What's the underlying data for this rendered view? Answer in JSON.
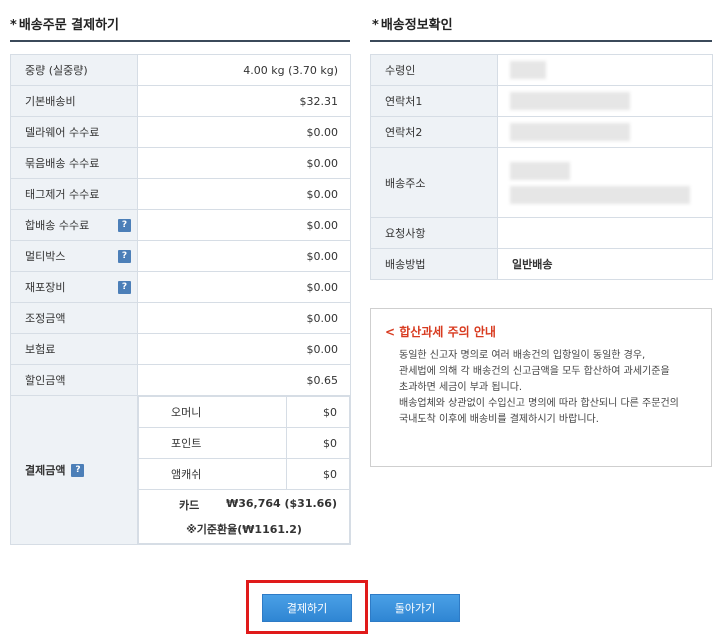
{
  "order_section": {
    "star": "*",
    "title": "배송주문 결제하기",
    "rows": [
      {
        "label": "중량 (실중량)",
        "value": "4.00 kg (3.70 kg)",
        "help": false
      },
      {
        "label": "기본배송비",
        "value": "$32.31",
        "help": false
      },
      {
        "label": "델라웨어 수수료",
        "value": "$0.00",
        "help": false
      },
      {
        "label": "묶음배송 수수료",
        "value": "$0.00",
        "help": false
      },
      {
        "label": "태그제거 수수료",
        "value": "$0.00",
        "help": false
      },
      {
        "label": "합배송 수수료",
        "value": "$0.00",
        "help": true
      },
      {
        "label": "멀티박스",
        "value": "$0.00",
        "help": true
      },
      {
        "label": "재포장비",
        "value": "$0.00",
        "help": true
      },
      {
        "label": "조정금액",
        "value": "$0.00",
        "help": false
      },
      {
        "label": "보험료",
        "value": "$0.00",
        "help": false
      },
      {
        "label": "할인금액",
        "value": "$0.65",
        "help": false
      }
    ],
    "payment": {
      "label": "결제금액",
      "help_glyph": "?",
      "items": [
        {
          "label": "오머니",
          "value": "$0"
        },
        {
          "label": "포인트",
          "value": "$0"
        },
        {
          "label": "앰캐쉬",
          "value": "$0"
        }
      ],
      "card_label": "카드",
      "card_value": "₩36,764 ($31.66)",
      "exchange_rate": "※기준환율(₩1161.2)"
    }
  },
  "shipping_section": {
    "star": "*",
    "title": "배송정보확인",
    "rows": [
      {
        "label": "수령인"
      },
      {
        "label": "연락처1"
      },
      {
        "label": "연락처2"
      },
      {
        "label": "배송주소"
      },
      {
        "label": "요청사항"
      },
      {
        "label": "배송방법"
      }
    ],
    "shipping_method": "일반배송"
  },
  "notice": {
    "title": "< 합산과세 주의 안내",
    "lines": [
      "동일한 신고자 명의로 여러 배송건의 입항일이 동일한 경우,",
      "관세법에 의해 각 배송건의 신고금액을 모두 합산하여 과세기준을",
      "초과하면 세금이 부과 됩니다.",
      "배송업체와 상관없이 수입신고 명의에 따라 합산되니 다른 주문건의",
      "국내도착 이후에 배송비를 결제하시기 바랍니다."
    ]
  },
  "buttons": {
    "pay": "결제하기",
    "back": "돌아가기"
  },
  "colors": {
    "accent_button": "#2f86d3",
    "highlight_frame": "#e01a1a",
    "shipping_method": "#e8641b",
    "notice_title": "#d83b20"
  }
}
